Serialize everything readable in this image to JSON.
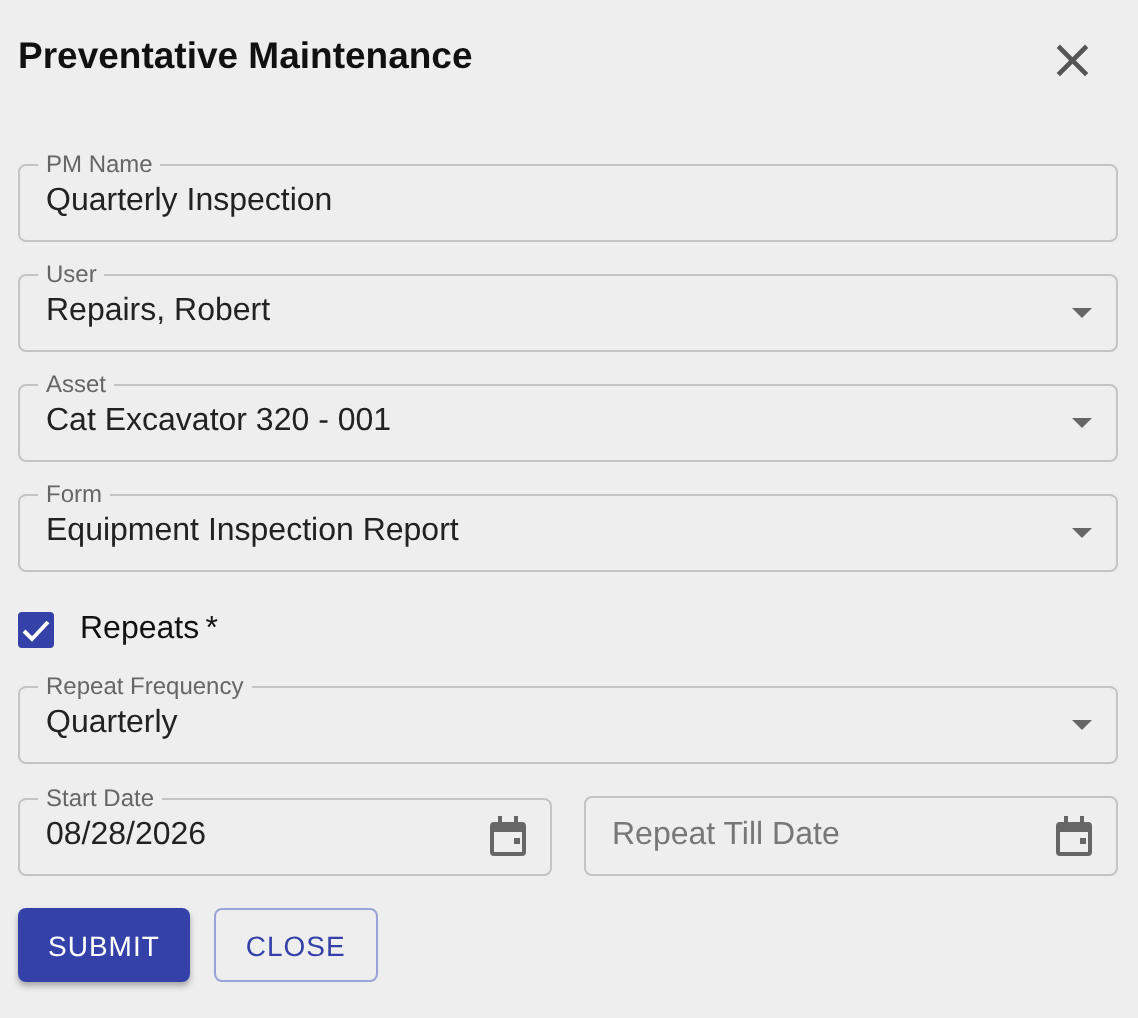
{
  "dialog": {
    "title": "Preventative Maintenance",
    "close_icon": "×"
  },
  "fields": [
    {
      "kind": "text",
      "label": "PM Name",
      "value": "Quarterly Inspection"
    },
    {
      "kind": "select",
      "label": "User",
      "value": "Repairs, Robert"
    },
    {
      "kind": "select",
      "label": "Asset",
      "value": "Cat Excavator 320 - 001"
    },
    {
      "kind": "select",
      "label": "Form",
      "value": "Equipment Inspection Report"
    }
  ],
  "repeats": {
    "label": "Repeats",
    "required_mark": "*",
    "checked": true
  },
  "repeat_frequency": {
    "kind": "select",
    "label": "Repeat Frequency",
    "value": "Quarterly"
  },
  "dates": [
    {
      "kind": "date",
      "label": "Start Date",
      "value": "08/28/2026"
    },
    {
      "kind": "date",
      "placeholder": "Repeat Till Date"
    }
  ],
  "buttons": [
    {
      "kind": "primary",
      "label": "SUBMIT"
    },
    {
      "kind": "outlined",
      "label": "CLOSE"
    }
  ]
}
